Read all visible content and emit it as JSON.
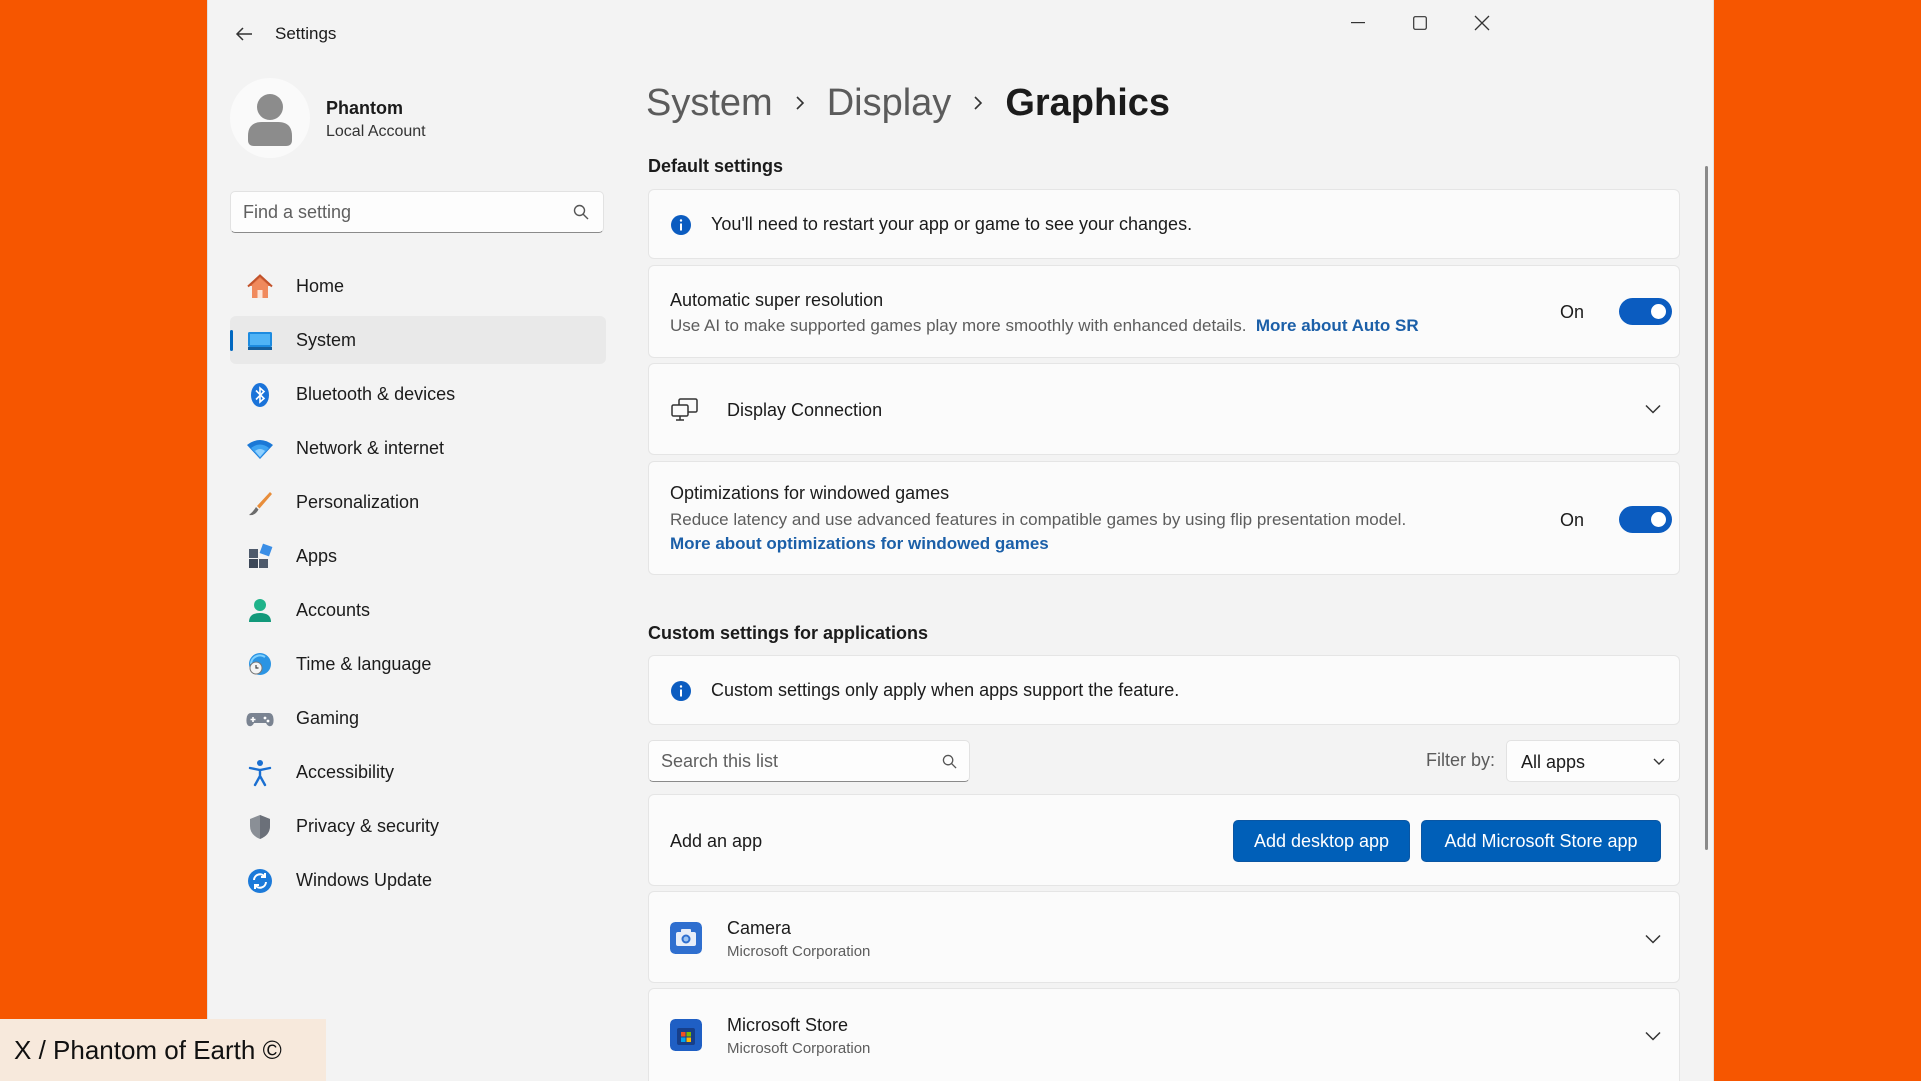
{
  "window": {
    "title": "Settings"
  },
  "profile": {
    "name": "Phantom",
    "account_type": "Local Account"
  },
  "search": {
    "placeholder": "Find a setting"
  },
  "nav": {
    "items": [
      {
        "label": "Home",
        "icon": "home-icon"
      },
      {
        "label": "System",
        "icon": "system-icon"
      },
      {
        "label": "Bluetooth & devices",
        "icon": "bluetooth-icon"
      },
      {
        "label": "Network & internet",
        "icon": "wifi-icon"
      },
      {
        "label": "Personalization",
        "icon": "brush-icon"
      },
      {
        "label": "Apps",
        "icon": "apps-icon"
      },
      {
        "label": "Accounts",
        "icon": "person-icon"
      },
      {
        "label": "Time & language",
        "icon": "clock-globe-icon"
      },
      {
        "label": "Gaming",
        "icon": "controller-icon"
      },
      {
        "label": "Accessibility",
        "icon": "accessibility-icon"
      },
      {
        "label": "Privacy & security",
        "icon": "shield-icon"
      },
      {
        "label": "Windows Update",
        "icon": "update-icon"
      }
    ],
    "active": "System"
  },
  "breadcrumb": {
    "items": [
      "System",
      "Display"
    ],
    "current": "Graphics"
  },
  "default_settings": {
    "title": "Default settings",
    "info": "You'll need to restart your app or game to see your changes.",
    "auto_sr": {
      "title": "Automatic super resolution",
      "description": "Use AI to make supported games play more smoothly with enhanced details.",
      "link": "More about Auto SR",
      "state_label": "On"
    },
    "display_connection": {
      "title": "Display Connection"
    },
    "windowed_games": {
      "title": "Optimizations for windowed games",
      "description": "Reduce latency and use advanced features in compatible games by using flip presentation model.",
      "link": "More about optimizations for windowed games",
      "state_label": "On"
    }
  },
  "custom_settings": {
    "title": "Custom settings for applications",
    "info": "Custom settings only apply when apps support the feature.",
    "search_placeholder": "Search this list",
    "filter_label": "Filter by:",
    "filter_value": "All apps",
    "add_app": {
      "label": "Add an app",
      "desktop_button": "Add desktop app",
      "store_button": "Add Microsoft Store app"
    },
    "apps": [
      {
        "name": "Camera",
        "publisher": "Microsoft Corporation",
        "icon": "camera-app-icon"
      },
      {
        "name": "Microsoft Store",
        "publisher": "Microsoft Corporation",
        "icon": "store-app-icon"
      }
    ]
  },
  "watermark": "X / Phantom of Earth ©",
  "colors": {
    "accent": "#005fb8",
    "background": "#F65600",
    "window": "#f3f3f3"
  }
}
